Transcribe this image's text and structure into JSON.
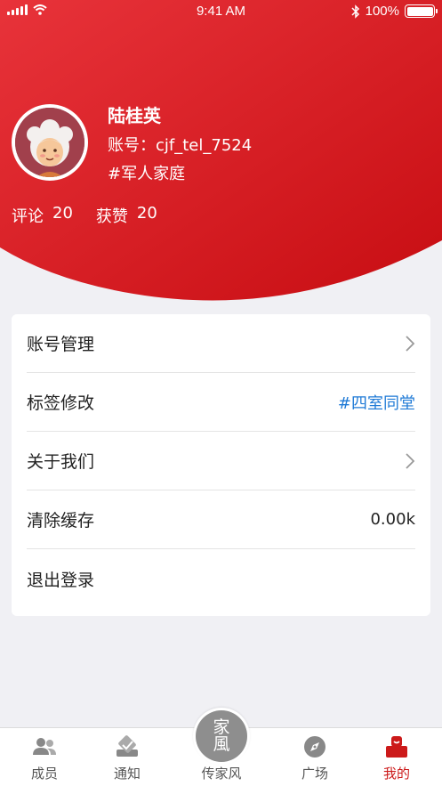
{
  "status_bar": {
    "time": "9:41 AM",
    "battery": "100%",
    "icons": [
      "signal-icon",
      "wifi-icon",
      "bluetooth-icon",
      "battery-icon"
    ]
  },
  "profile": {
    "name": "陆桂英",
    "account": "账号：cjf_tel_7524",
    "tag": "#军人家庭",
    "stats": [
      {
        "label": "评论",
        "value": "20"
      },
      {
        "label": "获赞",
        "value": "20"
      }
    ]
  },
  "settings": {
    "items": [
      {
        "label": "账号管理",
        "value": "",
        "icon": "chevron-right-icon"
      },
      {
        "label": "标签修改",
        "value": "#四室同堂"
      },
      {
        "label": "关于我们",
        "value": "",
        "icon": "chevron-right-icon"
      },
      {
        "label": "清除缓存",
        "value": "0.00k"
      },
      {
        "label": "退出登录",
        "value": ""
      }
    ]
  },
  "tabbar": {
    "tabs": [
      {
        "label": "成员",
        "icon": "members-icon"
      },
      {
        "label": "通知",
        "icon": "notice-icon"
      },
      {
        "label": "传家风",
        "icon": "family-style-icon"
      },
      {
        "label": "广场",
        "icon": "compass-icon"
      },
      {
        "label": "我的",
        "icon": "profile-icon",
        "active": true
      }
    ],
    "center_glyphs": [
      "家",
      "風"
    ]
  },
  "colors": {
    "brand_red": "#d41a1f",
    "link_blue": "#1f7ad6",
    "active_tab": "#cc1a1a"
  }
}
